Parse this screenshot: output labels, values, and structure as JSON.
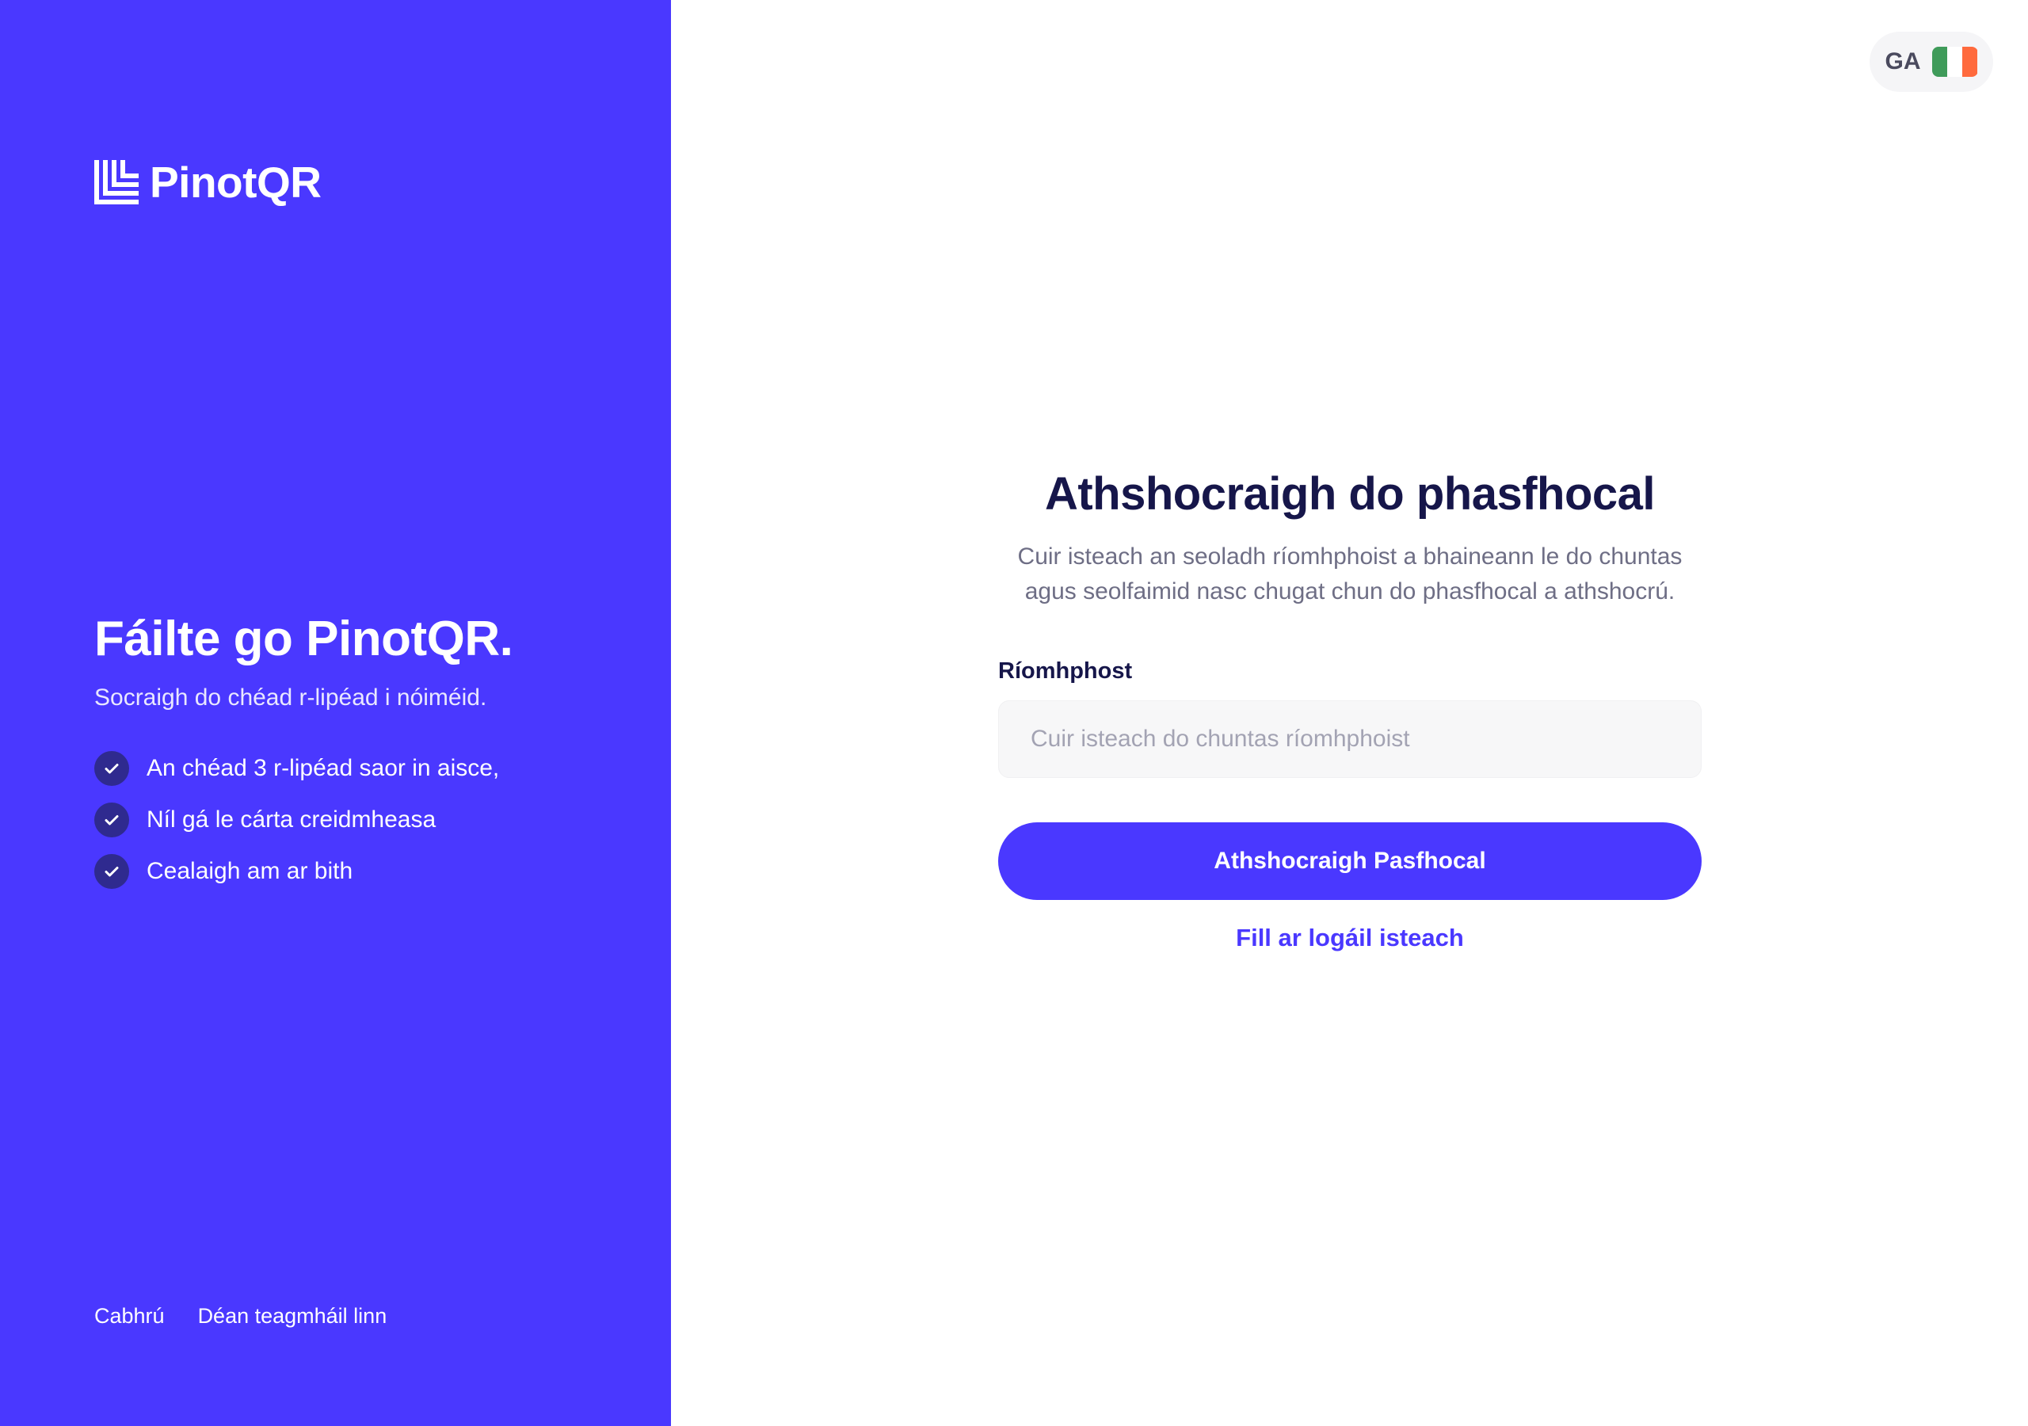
{
  "brand": {
    "name": "PinotQR",
    "accent": "#4a38ff"
  },
  "left_panel": {
    "title": "Fáilte go PinotQR.",
    "subtitle": "Socraigh do chéad r-lipéad i nóiméid.",
    "features": [
      "An chéad 3 r-lipéad saor in aisce,",
      "Níl gá le cárta creidmheasa",
      "Cealaigh am ar bith"
    ],
    "footer_links": {
      "help": "Cabhrú",
      "contact": "Déan teagmháil linn"
    }
  },
  "language": {
    "code": "GA",
    "icon": "ireland-flag-icon",
    "flag_colors": [
      "#3f9b5a",
      "#ffffff",
      "#ff6a3d"
    ]
  },
  "form": {
    "title": "Athshocraigh do phasfhocal",
    "description": "Cuir isteach an seoladh ríomhphoist a bhaineann le do chuntas agus seolfaimid nasc chugat chun do phasfhocal a athshocrú.",
    "email_label": "Ríomhphost",
    "email_placeholder": "Cuir isteach do chuntas ríomhphoist",
    "email_value": "",
    "submit_label": "Athshocraigh Pasfhocal",
    "back_link": "Fill ar logáil isteach"
  }
}
